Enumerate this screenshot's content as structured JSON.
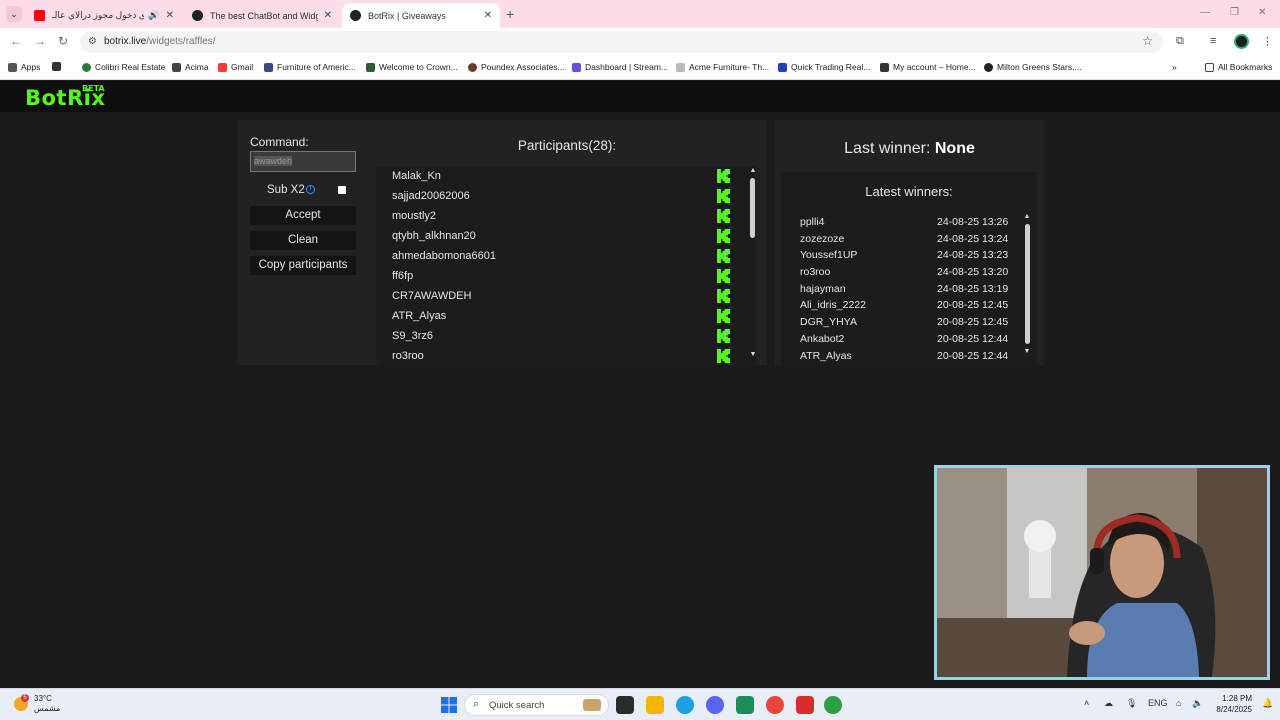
{
  "browser": {
    "tabs": [
      {
        "title": "اقوى دخول مجوز درالاي عالـ",
        "active": false
      },
      {
        "title": "The best ChatBot and Widgets",
        "active": false
      },
      {
        "title": "BotRix | Giveaways",
        "active": true
      }
    ],
    "new_tab": "+",
    "url_host": "botrix.live",
    "url_path": "/widgets/raffles/",
    "bookmarks": [
      "Apps",
      "Colibri Real Estate",
      "Acima",
      "Gmail",
      "Furniture of Americ...",
      "Welcome to Crown...",
      "Poundex Associates...",
      "Dashboard | Stream...",
      "Acme Furniture- Th...",
      "Quick Trading Real...",
      "My account – Home...",
      "Milton Greens Stars,..."
    ],
    "all_bookmarks": "All Bookmarks"
  },
  "site": {
    "logo": "BotRix",
    "logo_badge": "BETA"
  },
  "raffle": {
    "command_label": "Command:",
    "command_value": "awawdeh",
    "sub_label": "Sub X2",
    "sub_checked": false,
    "accept_label": "Accept",
    "clean_label": "Clean",
    "copy_label": "Copy participants",
    "participants_title": "Participants(28):",
    "participants": [
      "Malak_Kn",
      "sajjad20062006",
      "moustly2",
      "qtybh_alkhnan20",
      "ahmedabomona6601",
      "ff6fp",
      "CR7AWAWDEH",
      "ATR_Alyas",
      "S9_3rz6",
      "ro3roo"
    ],
    "platform_icon": "kick-icon",
    "platform_color": "#53fc18"
  },
  "winners": {
    "last_winner_label": "Last winner:",
    "last_winner_value": "None",
    "latest_title": "Latest winners:",
    "list": [
      {
        "name": "pplli4",
        "date": "24-08-25 13:26"
      },
      {
        "name": "zozezoze",
        "date": "24-08-25 13:24"
      },
      {
        "name": "Youssef1UP",
        "date": "24-08-25 13:23"
      },
      {
        "name": "ro3roo",
        "date": "24-08-25 13:20"
      },
      {
        "name": "hajayman",
        "date": "24-08-25 13:19"
      },
      {
        "name": "Ali_idris_2222",
        "date": "20-08-25 12:45"
      },
      {
        "name": "DGR_YHYA",
        "date": "20-08-25 12:45"
      },
      {
        "name": "Ankabot2",
        "date": "20-08-25 12:44"
      },
      {
        "name": "ATR_Alyas",
        "date": "20-08-25 12:44"
      }
    ]
  },
  "taskbar": {
    "weather_temp": "33°C",
    "weather_desc": "مشمس",
    "weather_badge": "5",
    "search_label": "Quick search",
    "lang": "ENG",
    "time": "1:28 PM",
    "date": "8/24/2025"
  }
}
